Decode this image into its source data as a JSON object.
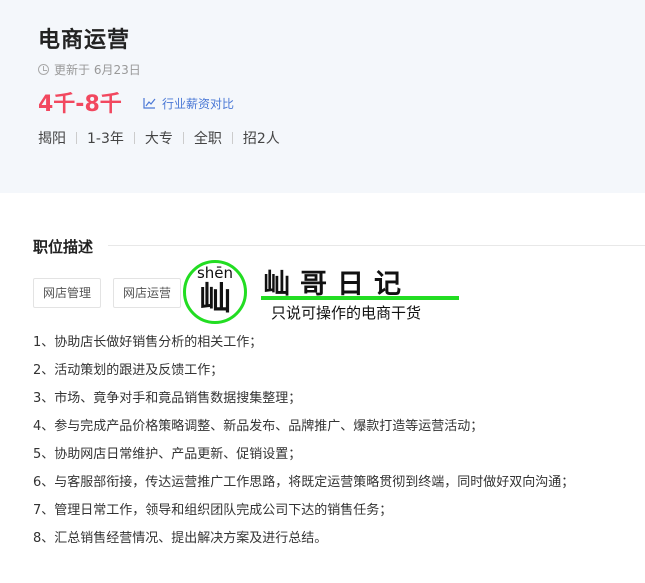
{
  "job": {
    "title": "电商运营",
    "updated": "更新于 6月23日",
    "salary": "4千-8千",
    "compare_label": "行业薪资对比",
    "tags": [
      "揭阳",
      "1-3年",
      "大专",
      "全职",
      "招2人"
    ]
  },
  "section": {
    "title": "职位描述"
  },
  "skills": [
    "网店管理",
    "网店运营"
  ],
  "watermark": {
    "pinyin": "shēn",
    "glyph": "屾",
    "brand": "屾哥日记",
    "slogan": "只说可操作的电商干货",
    "accent_color": "#22dd22"
  },
  "duties": [
    "1、协助店长做好销售分析的相关工作；",
    "2、活动策划的跟进及反馈工作；",
    "3、市场、竟争对手和竟品销售数据搜集整理；",
    "4、参与完成产品价格策略调整、新品发布、品牌推广、爆款打造等运营活动；",
    "5、协助网店日常维护、产品更新、促销设置；",
    "6、与客服部衔接，传达运营推广工作思路，将既定运营策略贯彻到终端，同时做好双向沟通；",
    "7、管理日常工作，领导和组织团队完成公司下达的销售任务；",
    "8、汇总销售经营情况、提出解决方案及进行总结。"
  ],
  "colors": {
    "salary": "#f2485f",
    "link": "#4a78d6",
    "header_bg": "#f4f7fb"
  }
}
